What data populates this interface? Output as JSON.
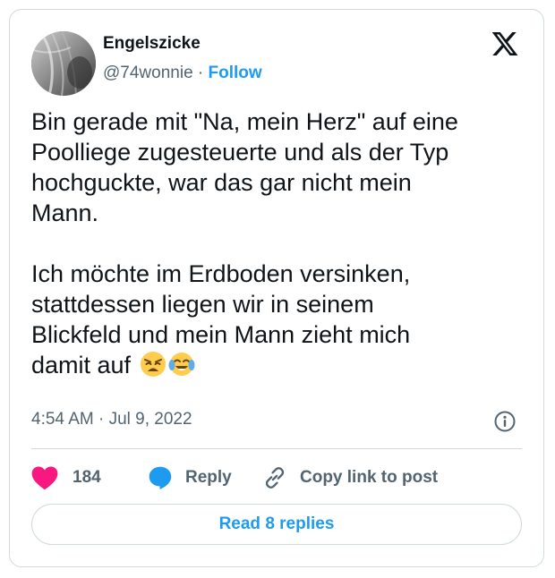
{
  "author": {
    "display_name": "Engelszicke",
    "handle": "@74wonnie",
    "separator": "·",
    "follow_label": "Follow"
  },
  "platform_logo": "x-logo-icon",
  "tweet": {
    "paragraph_1": "Bin gerade mit \"Na, mein Herz\" auf eine\nPoolliege zugesteuerte und als der Typ\nhochguckte, war das gar nicht mein\nMann.",
    "paragraph_2": "Ich möchte im Erdboden versinken,\nstattdessen liegen wir in seinem\nBlickfeld und mein Mann zieht mich\ndamit auf",
    "emojis": [
      "weary-face-emoji",
      "face-with-tears-of-joy-emoji"
    ]
  },
  "meta": {
    "time": "4:54 AM",
    "separator": "·",
    "date": "Jul 9, 2022",
    "info_icon": "info-icon"
  },
  "actions": {
    "like_count": "184",
    "reply_label": "Reply",
    "copy_link_label": "Copy link to post"
  },
  "read_replies_label": "Read 8 replies",
  "colors": {
    "accent": "#1d9bf0",
    "like": "#f91880",
    "text": "#0f1419",
    "secondary_text": "#536471",
    "border": "#cfd9de"
  }
}
